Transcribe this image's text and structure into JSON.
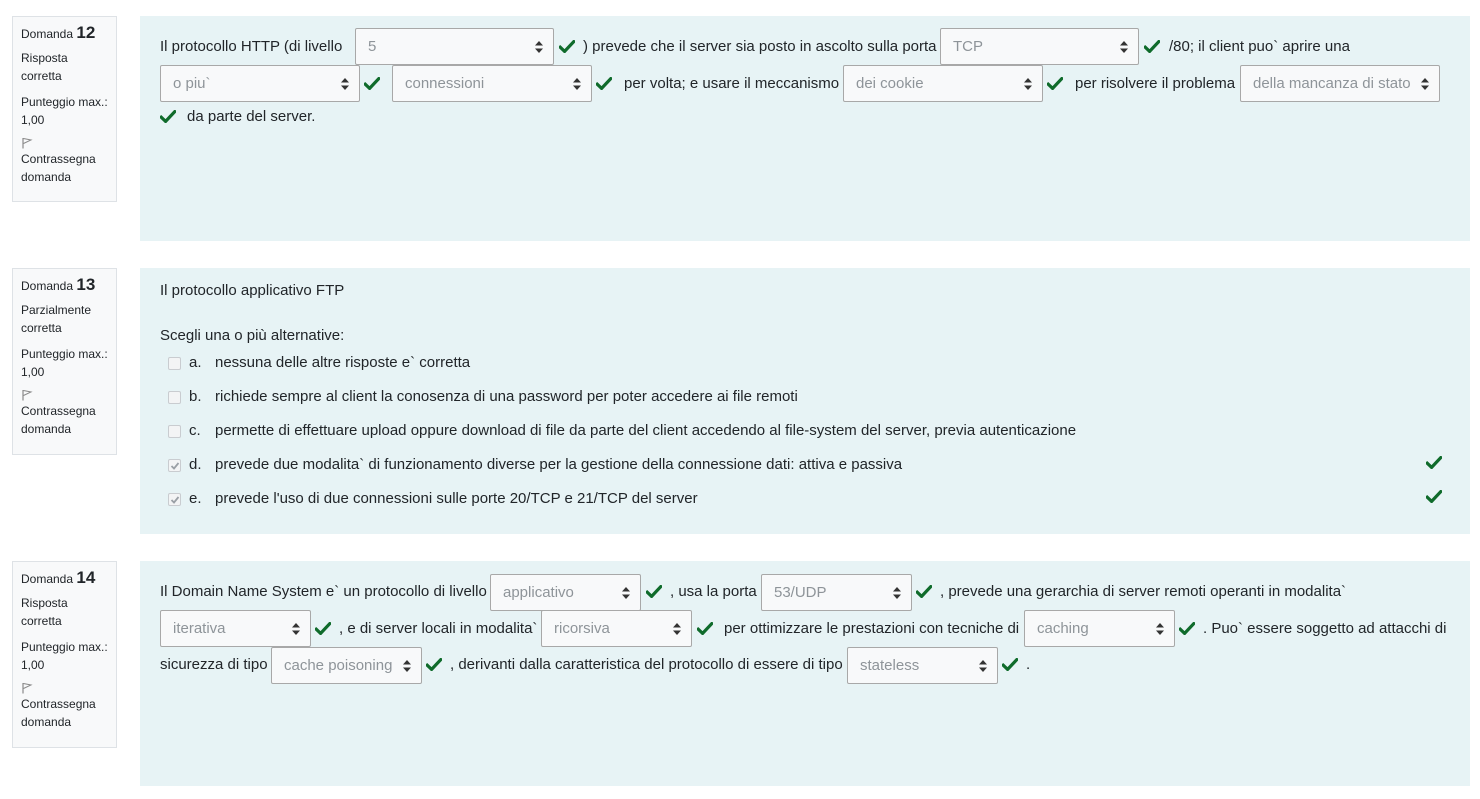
{
  "common": {
    "domanda_label": "Domanda",
    "punteggio_label": "Punteggio max.:",
    "punteggio_value": "1,00",
    "flag_label_1": "Contrassegna",
    "flag_label_2": "domanda",
    "correct_color": "#0f6b2b"
  },
  "q12": {
    "number": "12",
    "state_1": "Risposta",
    "state_2": "corretta",
    "t1": "Il protocollo  HTTP  (di livello",
    "s1": "5",
    "t2": ") prevede che il server sia posto in ascolto sulla porta",
    "s2": "TCP",
    "t3": "/80; il client puo` aprire una",
    "s3": "o piu`",
    "s4": "connessioni",
    "t4": "per volta; e usare il meccanismo",
    "s5": "dei cookie",
    "t5": "per risolvere il problema",
    "s6": "della mancanza di stato",
    "t6": "da parte del server."
  },
  "q13": {
    "number": "13",
    "state_1": "Parzialmente",
    "state_2": "corretta",
    "question": "Il protocollo applicativo FTP",
    "prompt": "Scegli una o più alternative:",
    "options": [
      {
        "letter": "a.",
        "text": "nessuna delle altre risposte e` corretta",
        "checked": false
      },
      {
        "letter": "b.",
        "text": "richiede sempre al client  la conosenza di una password per poter accedere ai file remoti",
        "checked": false
      },
      {
        "letter": "c.",
        "text": "permette di effettuare upload oppure download di file da parte del client accedendo al file-system del server, previa autenticazione",
        "checked": false
      },
      {
        "letter": "d.",
        "text": "prevede due modalita` di funzionamento diverse per la gestione della connessione dati: attiva e passiva",
        "checked": true
      },
      {
        "letter": "e.",
        "text": "prevede l'uso di due connessioni sulle porte 20/TCP e 21/TCP del server",
        "checked": true
      }
    ]
  },
  "q14": {
    "number": "14",
    "state_1": "Risposta",
    "state_2": "corretta",
    "t1": "Il Domain Name System e` un protocollo di livello",
    "s1": "applicativo",
    "t2": ", usa la porta",
    "s2": "53/UDP",
    "t3": ", prevede una gerarchia di server remoti operanti in modalita`",
    "s3": "iterativa",
    "t4": ", e di server locali in modalita`",
    "s4": "ricorsiva",
    "t5": "per ottimizzare le prestazioni con tecniche di",
    "s5": "caching",
    "t6": ". Puo` essere soggetto ad attacchi di",
    "t7": "sicurezza di tipo",
    "s6": "cache poisoning",
    "t8": ", derivanti dalla caratteristica del protocollo di essere di tipo",
    "s7": "stateless",
    "t9": "."
  }
}
